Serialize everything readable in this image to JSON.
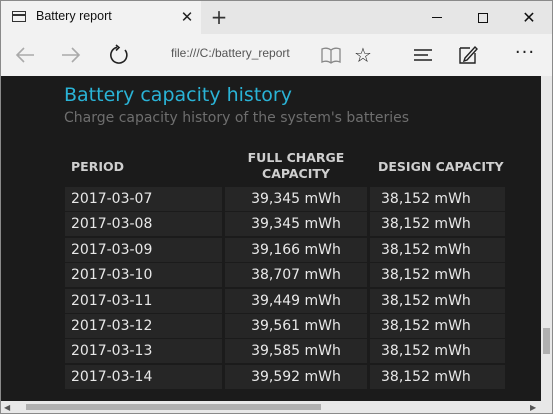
{
  "window": {
    "tab_title": "Battery report",
    "tab_close": "✕",
    "new_tab": "+",
    "close_glyph": "✕"
  },
  "nav": {
    "address": "file:///C:/battery_report",
    "back_icon": "arrow-left",
    "forward_icon": "arrow-right",
    "refresh_icon": "refresh",
    "favorite_glyph": "☆",
    "more_glyph": "···"
  },
  "report": {
    "title": "Battery capacity history",
    "subtitle": "Charge capacity history of the system's batteries",
    "columns": {
      "period": "PERIOD",
      "full_line1": "FULL CHARGE",
      "full_line2": "CAPACITY",
      "design": "DESIGN CAPACITY"
    },
    "rows": [
      {
        "period": "2017-03-07",
        "full": "39,345 mWh",
        "design": "38,152 mWh"
      },
      {
        "period": "2017-03-08",
        "full": "39,345 mWh",
        "design": "38,152 mWh"
      },
      {
        "period": "2017-03-09",
        "full": "39,166 mWh",
        "design": "38,152 mWh"
      },
      {
        "period": "2017-03-10",
        "full": "38,707 mWh",
        "design": "38,152 mWh"
      },
      {
        "period": "2017-03-11",
        "full": "39,449 mWh",
        "design": "38,152 mWh"
      },
      {
        "period": "2017-03-12",
        "full": "39,561 mWh",
        "design": "38,152 mWh"
      },
      {
        "period": "2017-03-13",
        "full": "39,585 mWh",
        "design": "38,152 mWh"
      },
      {
        "period": "2017-03-14",
        "full": "39,592 mWh",
        "design": "38,152 mWh"
      }
    ]
  },
  "colors": {
    "title_accent": "#2ab3d6",
    "row_even": "#262626",
    "row_odd": "#1f1f1f"
  }
}
